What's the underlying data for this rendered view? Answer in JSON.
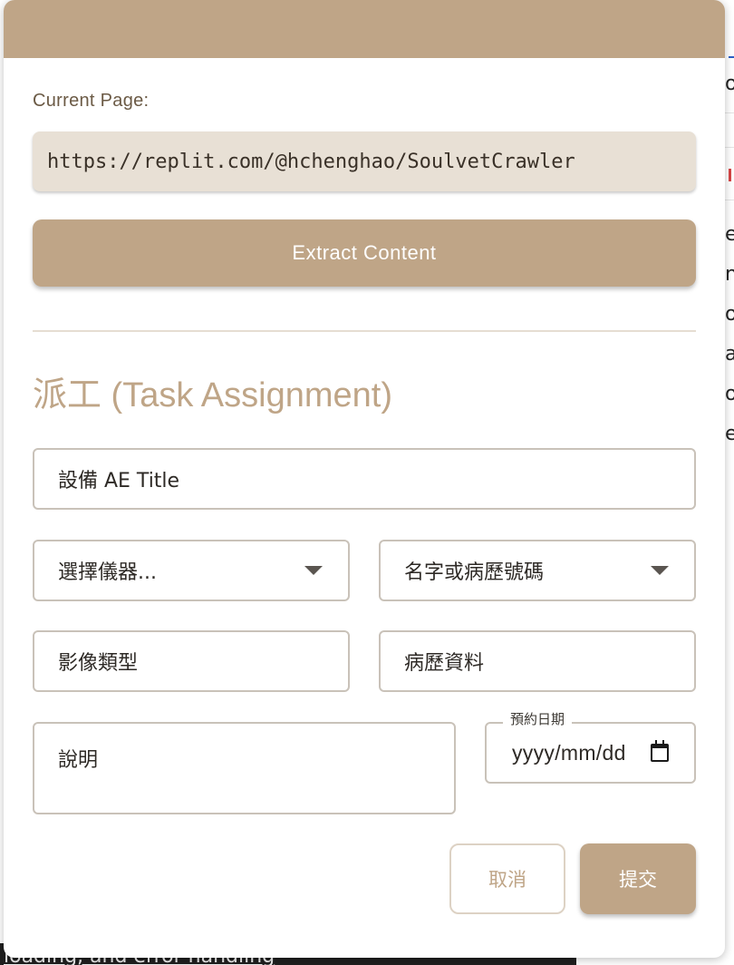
{
  "background": {
    "right_fragments": [
      "o",
      "e",
      "n",
      "o",
      "a",
      "o",
      "e"
    ],
    "bottom_text": "loading, and error handling"
  },
  "popup": {
    "current_page_label": "Current Page:",
    "current_url": "https://replit.com/@hchenghao/SoulvetCrawler",
    "extract_button": "Extract Content",
    "section_title": "派工 (Task Assignment)",
    "form": {
      "ae_title_value": "設備 AE Title",
      "instrument_select": "選擇儀器...",
      "patient_select": "名字或病歷號碼",
      "image_type_value": "影像類型",
      "medical_record_value": "病歷資料",
      "description_value": "說明",
      "date_label": "預約日期",
      "date_value": "yyyy/mm/dd"
    },
    "cancel_button": "取消",
    "submit_button": "提交"
  },
  "colors": {
    "accent": "#bfa587",
    "url_background": "#e8e0d5",
    "label_text": "#6b5a45"
  }
}
